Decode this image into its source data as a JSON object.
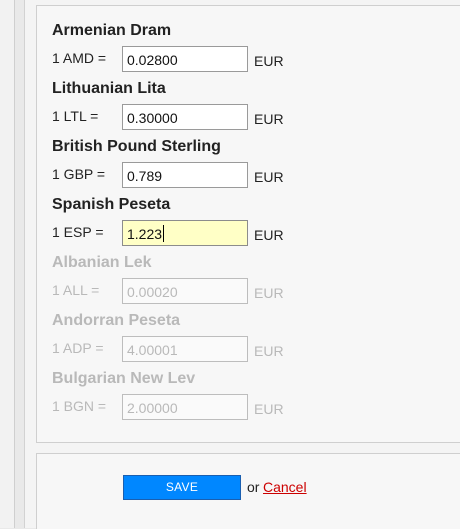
{
  "currencies": [
    {
      "name": "Armenian Dram",
      "prefix": "1 AMD =",
      "value": "0.02800",
      "suffix": "EUR",
      "enabled": true
    },
    {
      "name": "Lithuanian Lita",
      "prefix": "1 LTL =",
      "value": "0.30000",
      "suffix": "EUR",
      "enabled": true
    },
    {
      "name": "British Pound Sterling",
      "prefix": "1 GBP =",
      "value": "0.789",
      "suffix": "EUR",
      "enabled": true
    },
    {
      "name": "Spanish Peseta",
      "prefix": "1 ESP =",
      "value": "1.223",
      "suffix": "EUR",
      "enabled": true,
      "focused": true
    },
    {
      "name": "Albanian Lek",
      "prefix": "1 ALL =",
      "value": "0.00020",
      "suffix": "EUR",
      "enabled": false
    },
    {
      "name": "Andorran Peseta",
      "prefix": "1 ADP =",
      "value": "4.00001",
      "suffix": "EUR",
      "enabled": false
    },
    {
      "name": "Bulgarian New Lev",
      "prefix": "1 BGN =",
      "value": "2.00000",
      "suffix": "EUR",
      "enabled": false
    }
  ],
  "footer": {
    "save_label": "SAVE",
    "or_text": "or",
    "cancel_label": "Cancel"
  },
  "colors": {
    "save_button": "#0087ff",
    "cancel_link": "#cc0000",
    "focused_input": "#ffffc6",
    "disabled_text": "#b9b9b9"
  }
}
